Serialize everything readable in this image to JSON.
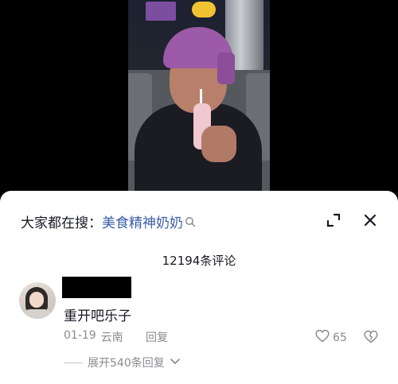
{
  "search": {
    "prefix": "大家都在搜：",
    "term": "美食精神奶奶"
  },
  "comments_header": {
    "count_label": "12194条评论"
  },
  "comment": {
    "text": "重开吧乐子",
    "date": "01-19",
    "location": "云南",
    "reply_label": "回复",
    "like_count": "65",
    "expand_label": "展开540条回复"
  },
  "colors": {
    "search_term": "#3a5ea8",
    "muted_text": "#8a8b91"
  },
  "icons": {
    "search_mini": "search-icon",
    "expand": "expand-icon",
    "close": "close-icon",
    "like": "heart-icon",
    "dislike": "broken-heart-icon",
    "chevron": "chevron-down-icon"
  }
}
